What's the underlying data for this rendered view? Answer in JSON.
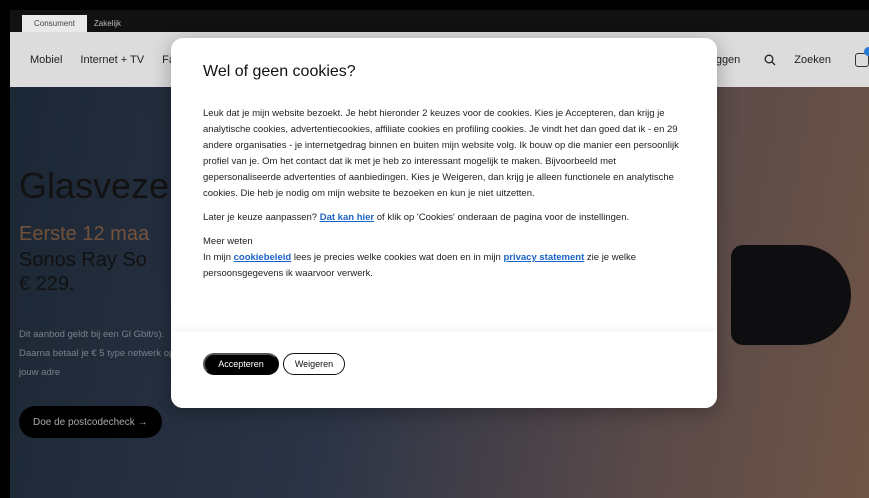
{
  "topbar": {
    "tabs": [
      "Consument",
      "Zakelijk"
    ]
  },
  "nav": {
    "items": [
      "Mobiel",
      "Internet + TV",
      "Fa"
    ],
    "login": "oggen",
    "search": "Zoeken"
  },
  "hero": {
    "title": "Glasveze",
    "promo": "Eerste 12 maa",
    "product": "Sonos Ray So",
    "price": "€ 229.",
    "fine_print": "Dit aanbod geldt bij een Gl Gbit/s). Daarna betaal je € 5 type netwerk op jouw adre",
    "cta": "Doe de postcodecheck →"
  },
  "modal": {
    "title": "Wel of geen cookies?",
    "paragraph1": "Leuk dat je mijn website bezoekt. Je hebt hieronder 2 keuzes voor de cookies. Kies je Accepteren, dan krijg je analytische cookies, advertentiecookies, affiliate cookies en profiling cookies. Je vindt het dan goed dat ik - en 29 andere organisaties - je internetgedrag binnen en buiten mijn website volg. Ik bouw op die manier een persoonlijk profiel van je. Om het contact dat ik met je heb zo interessant mogelijk te maken. Bijvoorbeeld met gepersonaliseerde advertenties of aanbiedingen. Kies je Weigeren, dan krijg je alleen functionele en analytische cookies. Die heb je nodig om mijn website te bezoeken en kun je niet uitzetten.",
    "p2_before": "Later je keuze aanpassen?",
    "p2_link": "Dat kan hier",
    "p2_after": "of klik op 'Cookies' onderaan de pagina voor de instellingen.",
    "more_title": "Meer weten",
    "p3_before": "In mijn",
    "p3_link1": "cookiebeleid",
    "p3_middle": "lees je precies welke cookies wat doen en in mijn",
    "p3_link2": "privacy statement",
    "p3_after": "zie je welke persoonsgegevens ik waarvoor verwerk.",
    "accept": "Accepteren",
    "decline": "Weigeren"
  }
}
